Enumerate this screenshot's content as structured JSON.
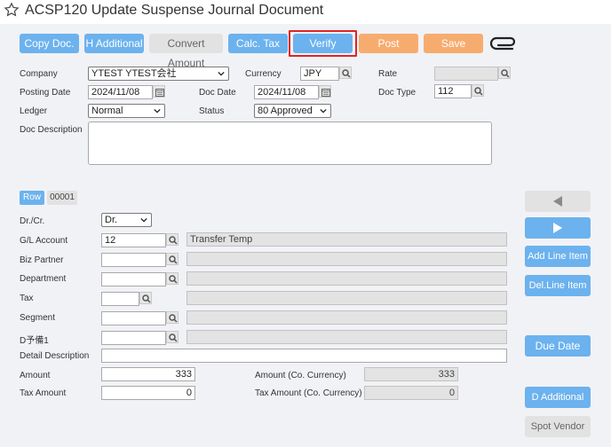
{
  "header": {
    "title": "ACSP120 Update Suspense Journal Document"
  },
  "toolbar": {
    "copy_doc": "Copy Doc.",
    "h_additional": "H Additional",
    "convert_amount": "Convert Amount",
    "calc_tax": "Calc. Tax",
    "verify": "Verify",
    "post": "Post",
    "save": "Save"
  },
  "form": {
    "company_label": "Company",
    "company_value": "YTEST YTEST会社",
    "currency_label": "Currency",
    "currency_value": "JPY",
    "rate_label": "Rate",
    "rate_value": "",
    "posting_date_label": "Posting Date",
    "posting_date_value": "2024/11/08",
    "doc_date_label": "Doc Date",
    "doc_date_value": "2024/11/08",
    "doc_type_label": "Doc Type",
    "doc_type_value": "112",
    "ledger_label": "Ledger",
    "ledger_value": "Normal",
    "status_label": "Status",
    "status_value": "80 Approved",
    "doc_description_label": "Doc Description",
    "doc_description_value": ""
  },
  "line": {
    "row_label": "Row",
    "row_number": "00001",
    "drcr_label": "Dr./Cr.",
    "drcr_value": "Dr.",
    "gl_account_label": "G/L Account",
    "gl_account_value": "12",
    "gl_account_name": "Transfer Temp",
    "biz_partner_label": "Biz Partner",
    "department_label": "Department",
    "tax_label": "Tax",
    "segment_label": "Segment",
    "d_reserve_label": "D予備1",
    "detail_description_label": "Detail Description",
    "amount_label": "Amount",
    "amount_value": "333",
    "amount_co_label": "Amount (Co. Currency)",
    "amount_co_value": "333",
    "tax_amount_label": "Tax Amount",
    "tax_amount_value": "0",
    "tax_amount_co_label": "Tax Amount (Co. Currency)",
    "tax_amount_co_value": "0"
  },
  "side": {
    "add_line_item": "Add Line Item",
    "del_line_item": "Del.Line Item",
    "due_date": "Due Date",
    "d_additional": "D Additional",
    "spot_vendor": "Spot Vendor"
  },
  "colors": {
    "accent_blue": "#6cb2ee",
    "accent_orange": "#f7ac6f",
    "highlight_red": "#e02424"
  }
}
